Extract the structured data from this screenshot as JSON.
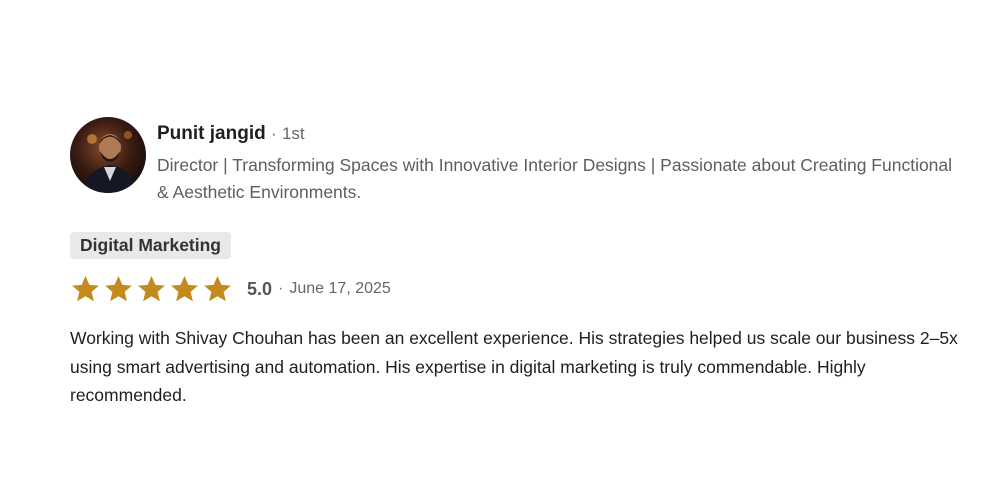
{
  "reviewer": {
    "name": "Punit jangid",
    "separator": "·",
    "degree": "1st",
    "headline": "Director | Transforming Spaces with Innovative Interior Designs | Passionate about Creating Functional & Aesthetic Environments."
  },
  "skill_tag": "Digital Marketing",
  "rating": {
    "stars_filled": 5,
    "stars_total": 5,
    "star_color": "#c58a1e",
    "score": "5.0",
    "separator": "·",
    "date": "June 17, 2025"
  },
  "review_text": "Working with Shivay Chouhan has been an excellent experience. His strategies helped us scale our business 2–5x using smart advertising and automation. His expertise in digital marketing is truly commendable. Highly recommended."
}
